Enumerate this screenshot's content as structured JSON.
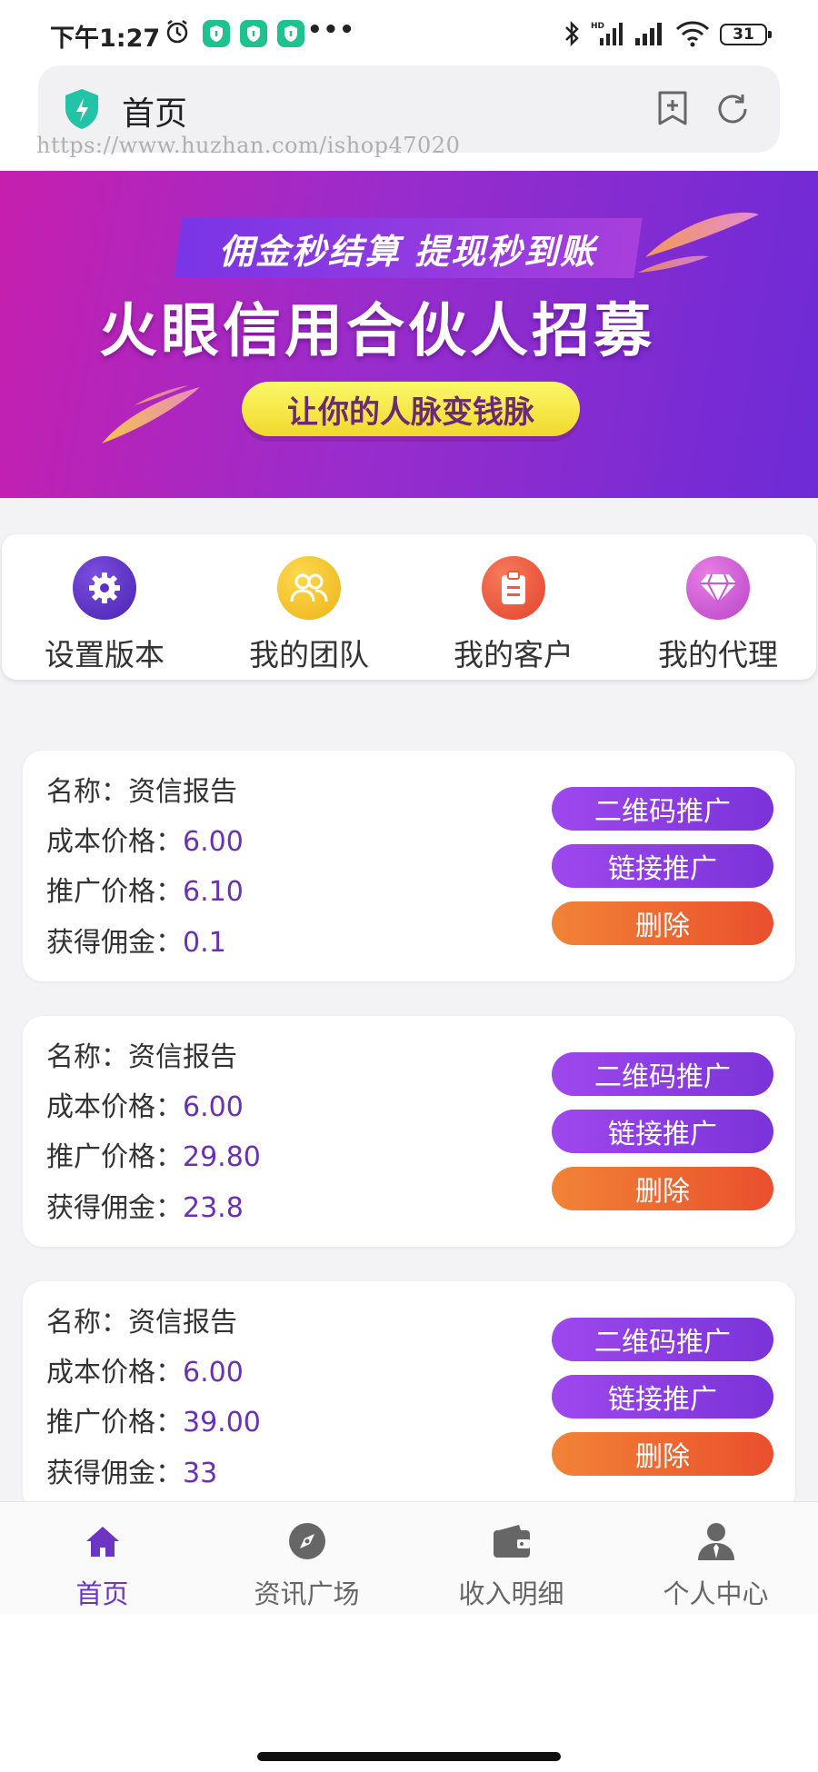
{
  "status_bar": {
    "time": "下午1:27",
    "battery": "31",
    "icons": [
      "alarm-icon",
      "app-shield-icon",
      "app-shield-icon",
      "app-shield-icon",
      "bluetooth-icon",
      "hd-signal-icon",
      "signal-icon",
      "wifi-icon"
    ]
  },
  "address_bar": {
    "title": "首页",
    "watermark": "https://www.huzhan.com/ishop47020"
  },
  "banner": {
    "tagline": "佣金秒结算 提现秒到账",
    "headline": "火眼信用合伙人招募",
    "slogan": "让你的人脉变钱脉"
  },
  "quick_menu": [
    {
      "label": "设置版本",
      "icon": "gear-icon",
      "color": "#5b2fc6"
    },
    {
      "label": "我的团队",
      "icon": "team-icon",
      "color": "#f4c224"
    },
    {
      "label": "我的客户",
      "icon": "clipboard-icon",
      "color": "#ef5a3e"
    },
    {
      "label": "我的代理",
      "icon": "diamond-icon",
      "color": "#cf54d6"
    }
  ],
  "labels": {
    "name": "名称：",
    "cost": "成本价格：",
    "promo": "推广价格：",
    "commission": "获得佣金："
  },
  "buttons": {
    "qr": "二维码推广",
    "link": "链接推广",
    "delete": "删除"
  },
  "products": [
    {
      "name": "资信报告",
      "cost": "6.00",
      "promo": "6.10",
      "commission": "0.1"
    },
    {
      "name": "资信报告",
      "cost": "6.00",
      "promo": "29.80",
      "commission": "23.8"
    },
    {
      "name": "资信报告",
      "cost": "6.00",
      "promo": "39.00",
      "commission": "33"
    }
  ],
  "tabs": [
    {
      "label": "首页",
      "icon": "home-icon",
      "active": true
    },
    {
      "label": "资讯广场",
      "icon": "compass-icon",
      "active": false
    },
    {
      "label": "收入明细",
      "icon": "wallet-icon",
      "active": false
    },
    {
      "label": "个人中心",
      "icon": "person-icon",
      "active": false
    }
  ],
  "colors": {
    "accent_purple": "#7a33d8",
    "accent_orange": "#ea4f2d",
    "value_text": "#6a30b8"
  }
}
